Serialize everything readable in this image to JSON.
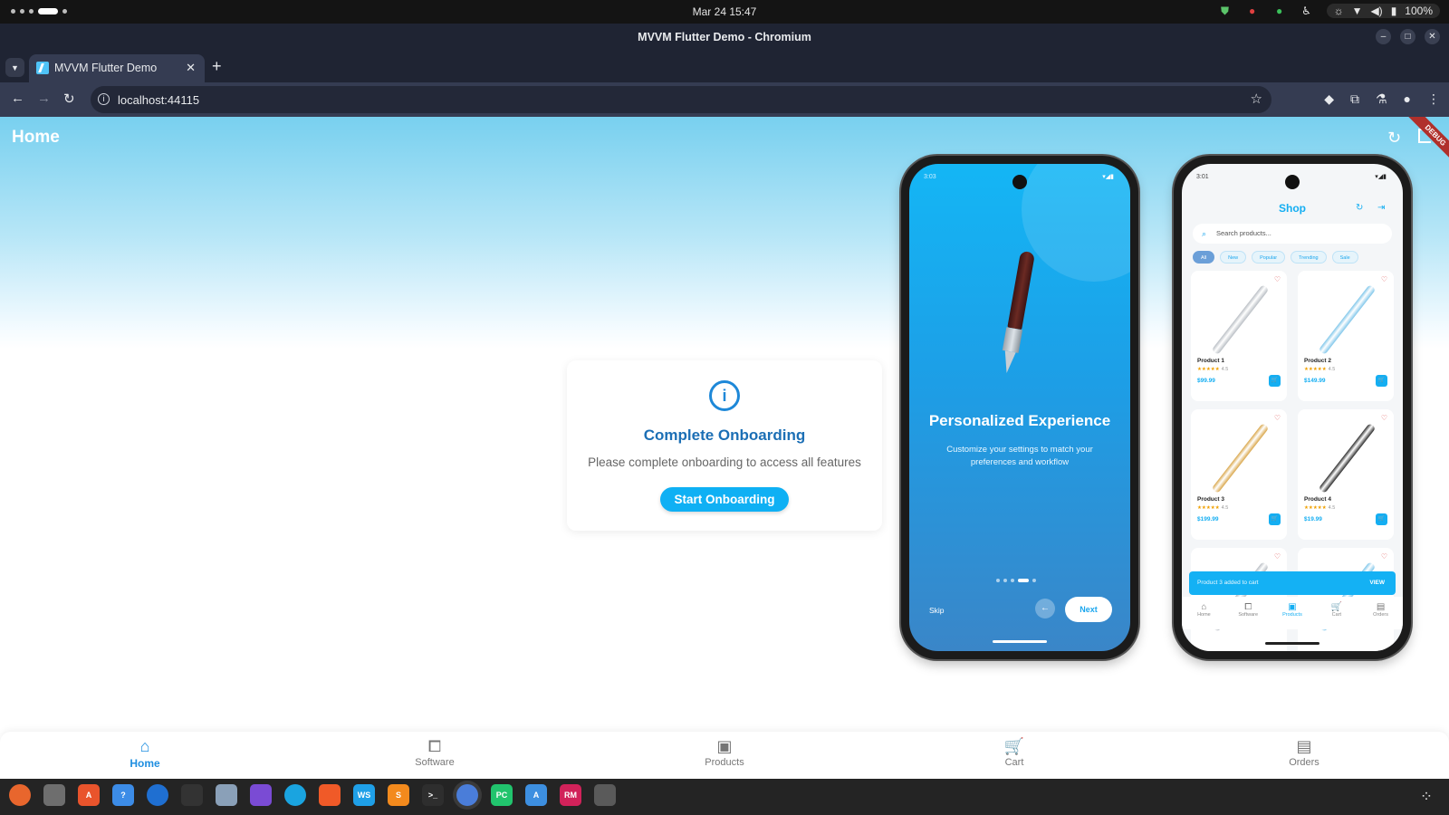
{
  "system": {
    "datetime": "Mar 24  15:47",
    "battery": "100%"
  },
  "window": {
    "title": "MVVM Flutter Demo - Chromium"
  },
  "browser": {
    "tab_title": "MVVM Flutter Demo",
    "url": "localhost:44115"
  },
  "app": {
    "title": "Home",
    "debug_label": "DEBUG",
    "card": {
      "heading": "Complete Onboarding",
      "message": "Please complete onboarding to access all features",
      "button": "Start Onboarding"
    },
    "phone_onboarding": {
      "time": "3:03",
      "heading": "Personalized Experience",
      "subtitle": "Customize your settings to match your preferences and workflow",
      "skip": "Skip",
      "next": "Next",
      "page_count": 5,
      "active_page": 4
    },
    "phone_shop": {
      "time": "3:01",
      "title": "Shop",
      "search_placeholder": "Search products...",
      "chips": [
        "All",
        "New",
        "Popular",
        "Trending",
        "Sale"
      ],
      "selected_chip": "All",
      "products": [
        {
          "name": "Product 1",
          "rating": "4.5",
          "price": "$99.99",
          "pen_color": "#b9bec4"
        },
        {
          "name": "Product 2",
          "rating": "4.5",
          "price": "$149.99",
          "pen_color": "#7fc6ea"
        },
        {
          "name": "Product 3",
          "rating": "4.5",
          "price": "$199.99",
          "pen_color": "#d9a64a"
        },
        {
          "name": "Product 4",
          "rating": "4.5",
          "price": "$19.99",
          "pen_color": "#2a2a2a"
        }
      ],
      "snackbar": "Product 3 added to cart",
      "snackbar_action": "VIEW",
      "nav": [
        "Home",
        "Software",
        "Products",
        "Cart",
        "Orders"
      ],
      "active_nav": "Products"
    },
    "bottom_nav": [
      {
        "label": "Home",
        "icon": "home-icon",
        "active": true
      },
      {
        "label": "Software",
        "icon": "software-icon",
        "active": false
      },
      {
        "label": "Products",
        "icon": "shopping-bag-icon",
        "active": false
      },
      {
        "label": "Cart",
        "icon": "cart-icon",
        "active": false
      },
      {
        "label": "Orders",
        "icon": "orders-icon",
        "active": false
      }
    ]
  },
  "dock": {
    "apps": [
      "firefox",
      "files",
      "app-center",
      "help",
      "thunderbird",
      "text-editor",
      "image-viewer",
      "obsidian",
      "edge",
      "brave",
      "webstorm",
      "sublime-text",
      "terminal",
      "chromium",
      "pycharm",
      "android-studio",
      "rubymine",
      "trash"
    ]
  }
}
